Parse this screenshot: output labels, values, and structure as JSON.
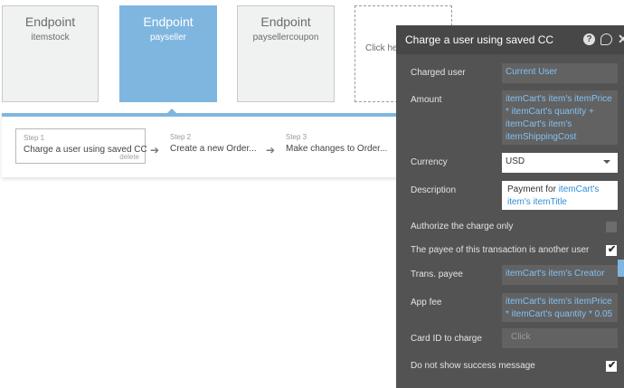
{
  "endpoints": [
    {
      "title": "Endpoint",
      "name": "itemstock",
      "active": false
    },
    {
      "title": "Endpoint",
      "name": "payseller",
      "active": true
    },
    {
      "title": "Endpoint",
      "name": "paysellercoupon",
      "active": false
    }
  ],
  "endpoint_add_label": "Click here to add an endpoint",
  "steps": [
    {
      "number": "Step 1",
      "label": "Charge a user using saved CC",
      "delete": "delete"
    },
    {
      "number": "Step 2",
      "label": "Create a new Order..."
    },
    {
      "number": "Step 3",
      "label": "Make changes to Order..."
    }
  ],
  "panel": {
    "title": "Charge a user using saved CC",
    "help_glyph": "?",
    "close_glyph": "✕",
    "fields": {
      "charged_user": {
        "label": "Charged user",
        "value": "Current User"
      },
      "amount": {
        "label": "Amount",
        "value": "itemCart's item's itemPrice * itemCart's quantity + itemCart's item's itemShippingCost"
      },
      "currency": {
        "label": "Currency",
        "value": "USD"
      },
      "description": {
        "label": "Description",
        "prefix": "Payment for ",
        "value": "itemCart's item's itemTitle"
      },
      "authorize": {
        "label": "Authorize the charge only",
        "checked": false
      },
      "payee_other": {
        "label": "The payee of this transaction is another user",
        "checked": true
      },
      "trans_payee": {
        "label": "Trans. payee",
        "value": "itemCart's item's Creator"
      },
      "app_fee": {
        "label": "App fee",
        "value": "itemCart's item's itemPrice * itemCart's quantity * 0.05"
      },
      "card_id": {
        "label": "Card ID to charge",
        "placeholder": "Click"
      },
      "no_success_msg": {
        "label": "Do not show success message",
        "checked": true
      }
    },
    "check_glyph": "✔"
  },
  "colors": {
    "accent": "#7fb6e0",
    "panel_bg": "#535353",
    "link_blue": "#82c1f3"
  }
}
